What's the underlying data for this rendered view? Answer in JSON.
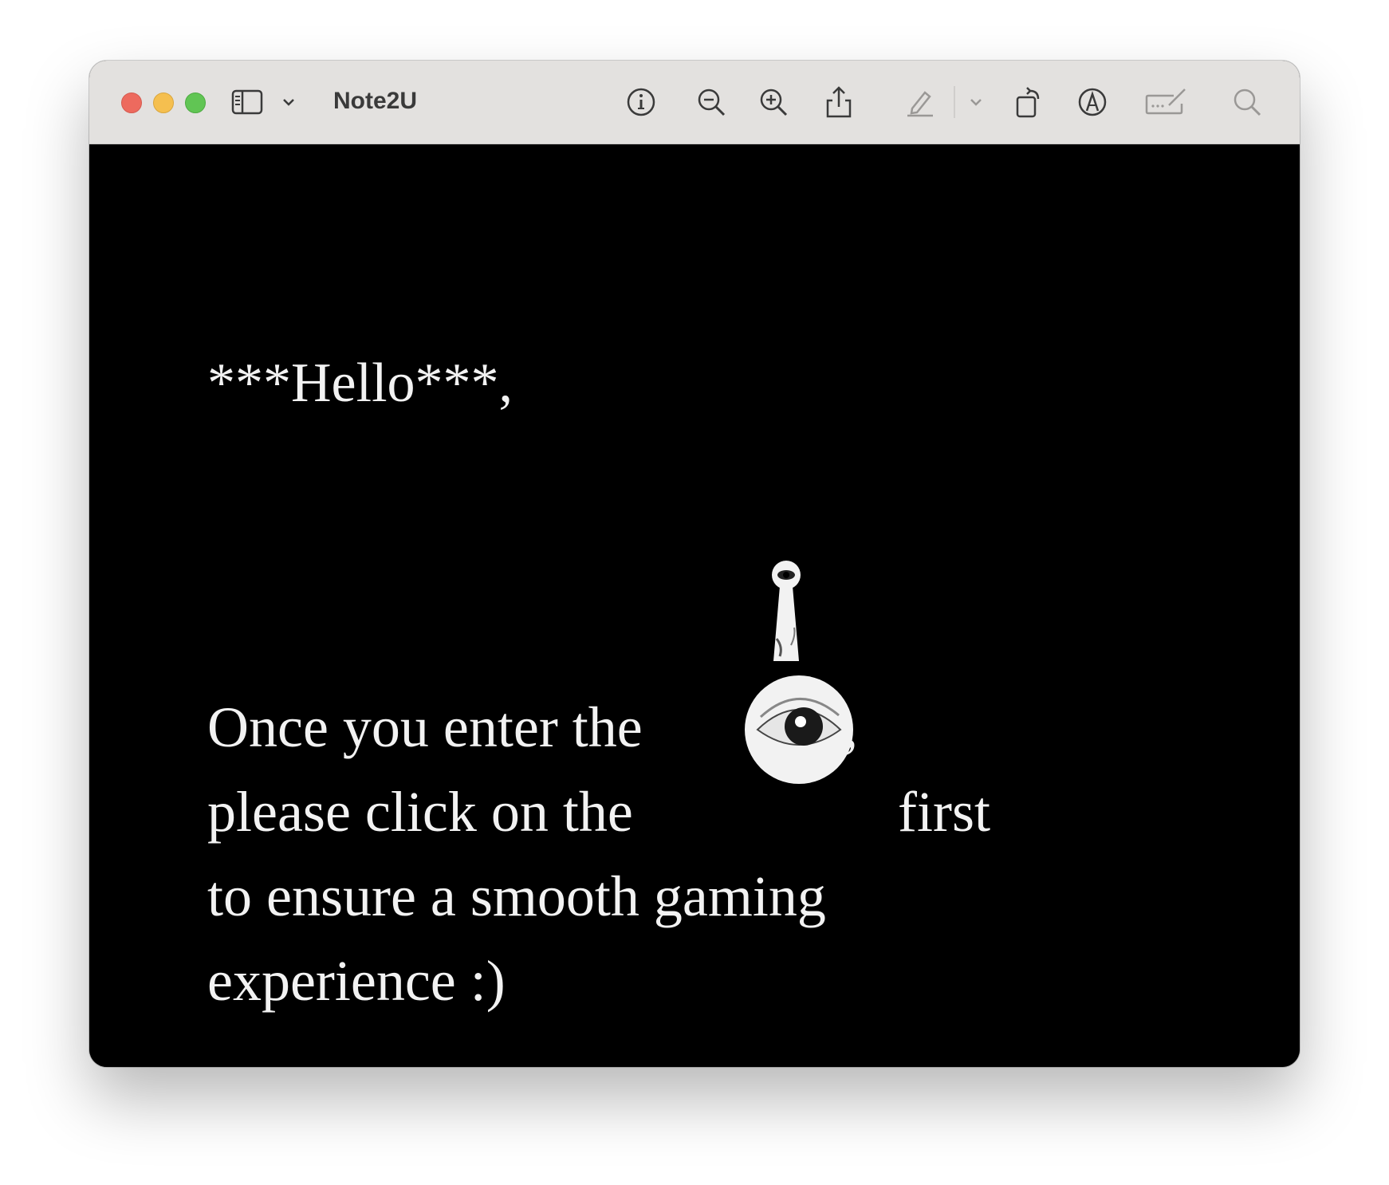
{
  "window": {
    "title": "Note2U"
  },
  "toolbar": {
    "icons": [
      "sidebar-icon",
      "chevron-down-icon",
      "info-icon",
      "zoom-out-icon",
      "zoom-in-icon",
      "share-icon",
      "highlight-icon",
      "chevron-down-icon",
      "rotate-icon",
      "markup-icon",
      "form-fill-icon",
      "search-icon"
    ]
  },
  "document": {
    "greeting": "***Hello***,",
    "line1_start": "Once you enter the",
    "line1_end": ",",
    "line2_start": "please click on the",
    "line2_end": "first",
    "line3": "to ensure a smooth gaming",
    "line4": "experience :)",
    "inline_images": [
      "keyhole-image",
      "eye-image"
    ]
  },
  "colors": {
    "titlebar": "#e3e1df",
    "background": "#000000",
    "text": "#f2f2f2",
    "close": "#ed6a5e",
    "minimize": "#f5bf4f",
    "maximize": "#61c554"
  }
}
